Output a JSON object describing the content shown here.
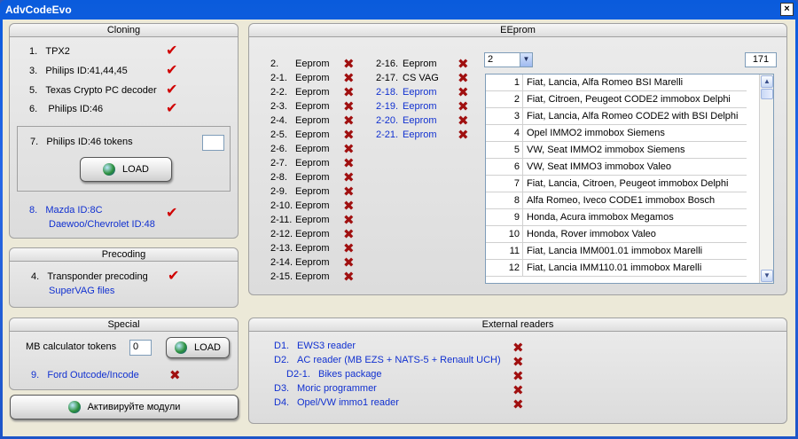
{
  "window": {
    "title": "AdvCodeEvo",
    "close_glyph": "×"
  },
  "cloning": {
    "header": "Cloning",
    "items": [
      {
        "num": "1.",
        "label": "TPX2",
        "status": "check"
      },
      {
        "num": "3.",
        "label": "Philips ID:41,44,45",
        "status": "check"
      },
      {
        "num": "5.",
        "label": "Texas Crypto PC decoder",
        "status": "check"
      },
      {
        "num": "6.",
        "label": "Philips ID:46",
        "status": "check"
      }
    ],
    "tokens": {
      "num": "7.",
      "label": "Philips ID:46 tokens",
      "value": "",
      "load_label": "LOAD"
    },
    "mazda": {
      "num": "8.",
      "line1": "Mazda ID:8C",
      "line2": "Daewoo/Chevrolet ID:48",
      "status": "check"
    }
  },
  "precoding": {
    "header": "Precoding",
    "item": {
      "num": "4.",
      "label": "Transponder precoding",
      "sub": "SuperVAG files",
      "status": "check"
    }
  },
  "special": {
    "header": "Special",
    "mb_label": "MB calculator tokens",
    "mb_value": "0",
    "load_label": "LOAD",
    "ford": {
      "num": "9.",
      "label": "Ford Outcode/Incode",
      "status": "cross"
    }
  },
  "activate_button": {
    "label": "Активируйте модули"
  },
  "eeprom": {
    "header": "EEprom",
    "combo_value": "2",
    "counter": "171",
    "col1": [
      {
        "num": "2.",
        "label": "Eeprom"
      },
      {
        "num": "2-1.",
        "label": "Eeprom"
      },
      {
        "num": "2-2.",
        "label": "Eeprom"
      },
      {
        "num": "2-3.",
        "label": "Eeprom"
      },
      {
        "num": "2-4.",
        "label": "Eeprom"
      },
      {
        "num": "2-5.",
        "label": "Eeprom"
      },
      {
        "num": "2-6.",
        "label": "Eeprom"
      },
      {
        "num": "2-7.",
        "label": "Eeprom"
      },
      {
        "num": "2-8.",
        "label": "Eeprom"
      },
      {
        "num": "2-9.",
        "label": "Eeprom"
      },
      {
        "num": "2-10.",
        "label": "Eeprom"
      },
      {
        "num": "2-11.",
        "label": "Eeprom"
      },
      {
        "num": "2-12.",
        "label": "Eeprom"
      },
      {
        "num": "2-13.",
        "label": "Eeprom"
      },
      {
        "num": "2-14.",
        "label": "Eeprom"
      },
      {
        "num": "2-15.",
        "label": "Eeprom"
      }
    ],
    "col2": [
      {
        "num": "2-16.",
        "label": "Eeprom",
        "blue": false
      },
      {
        "num": "2-17.",
        "label": "CS VAG",
        "blue": false
      },
      {
        "num": "2-18.",
        "label": "Eeprom",
        "blue": true
      },
      {
        "num": "2-19.",
        "label": "Eeprom",
        "blue": true
      },
      {
        "num": "2-20.",
        "label": "Eeprom",
        "blue": true
      },
      {
        "num": "2-21.",
        "label": "Eeprom",
        "blue": true
      }
    ],
    "list": [
      {
        "num": "1",
        "name": "Fiat, Lancia, Alfa Romeo BSI Marelli"
      },
      {
        "num": "2",
        "name": "Fiat, Citroen, Peugeot CODE2 immobox Delphi"
      },
      {
        "num": "3",
        "name": "Fiat, Lancia, Alfa Romeo CODE2 with BSI Delphi"
      },
      {
        "num": "4",
        "name": "Opel IMMO2 immobox Siemens"
      },
      {
        "num": "5",
        "name": "VW, Seat IMMO2 immobox Siemens"
      },
      {
        "num": "6",
        "name": "VW, Seat IMMO3 immobox Valeo"
      },
      {
        "num": "7",
        "name": "Fiat, Lancia, Citroen, Peugeot immobox Delphi"
      },
      {
        "num": "8",
        "name": "Alfa Romeo, Iveco CODE1 immobox Bosch"
      },
      {
        "num": "9",
        "name": "Honda, Acura immobox Megamos"
      },
      {
        "num": "10",
        "name": "Honda, Rover immobox Valeo"
      },
      {
        "num": "11",
        "name": "Fiat, Lancia IMM001.01 immobox Marelli"
      },
      {
        "num": "12",
        "name": "Fiat, Lancia IMM110.01 immobox Marelli"
      }
    ]
  },
  "external": {
    "header": "External readers",
    "items": [
      {
        "num": "D1.",
        "label": "EWS3 reader",
        "indent": false
      },
      {
        "num": "D2.",
        "label": "AC reader  (MB EZS + NATS-5 + Renault UCH)",
        "indent": false
      },
      {
        "num": "D2-1.",
        "label": "Bikes package",
        "indent": true
      },
      {
        "num": "D3.",
        "label": "Moric programmer",
        "indent": false
      },
      {
        "num": "D4.",
        "label": "Opel/VW immo1 reader",
        "indent": false
      }
    ]
  },
  "icons": {
    "check": "✔",
    "cross": "✖",
    "arrow_down": "▼",
    "arrow_up": "▲"
  }
}
